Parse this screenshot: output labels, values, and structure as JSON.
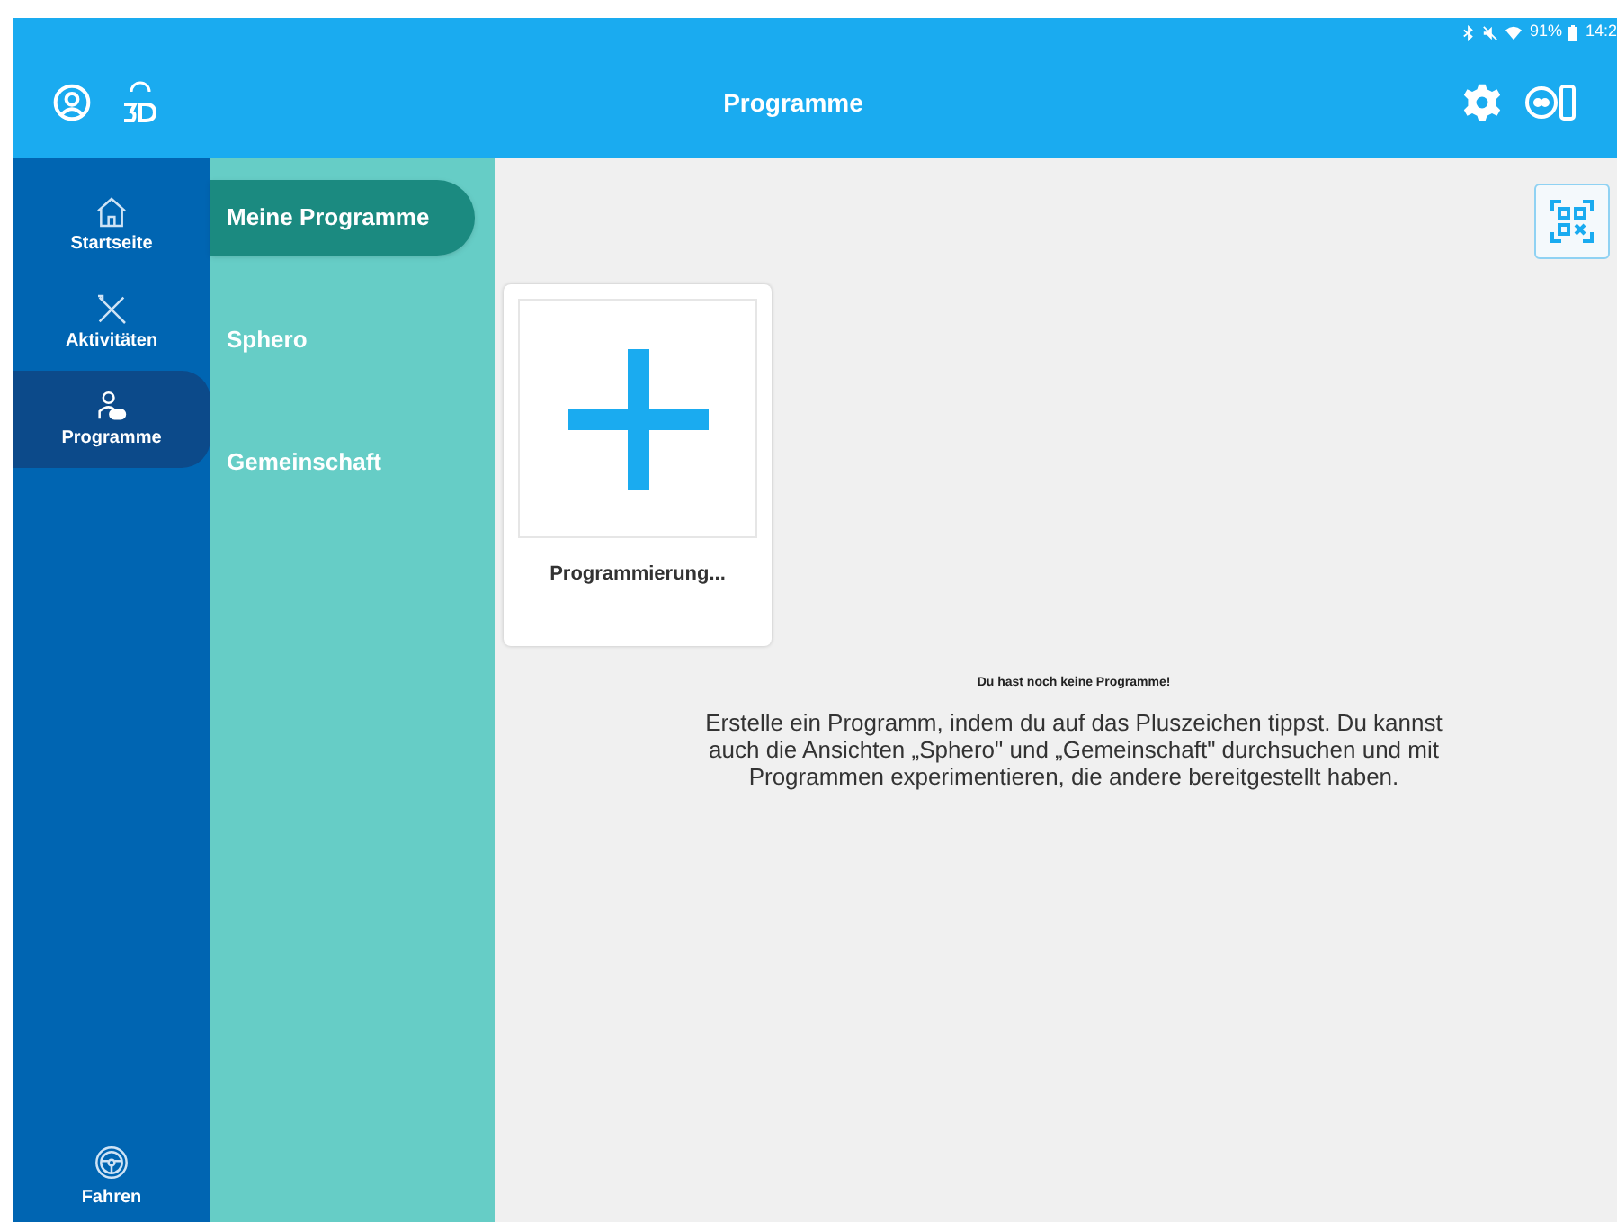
{
  "status_bar": {
    "battery_percent": "91%",
    "time": "14:2"
  },
  "header": {
    "title": "Programme"
  },
  "nav": [
    {
      "label": "Startseite",
      "selected": false
    },
    {
      "label": "Aktivitäten",
      "selected": false
    },
    {
      "label": "Programme",
      "selected": true
    }
  ],
  "nav_bottom": {
    "label": "Fahren"
  },
  "subnav": [
    {
      "label": "Meine Programme",
      "selected": true
    },
    {
      "label": "Sphero",
      "selected": false
    },
    {
      "label": "Gemeinschaft",
      "selected": false
    }
  ],
  "new_program_card": {
    "label": "Programmierung..."
  },
  "empty_state": {
    "title": "Du hast noch keine Programme!",
    "text": "Erstelle ein Programm, indem du auf das Pluszeichen tippst. Du kannst auch die Ansichten „Sphero\" und „Gemeinschaft\" durchsuchen und mit Programmen experimentieren, die andere bereitgestellt haben."
  }
}
